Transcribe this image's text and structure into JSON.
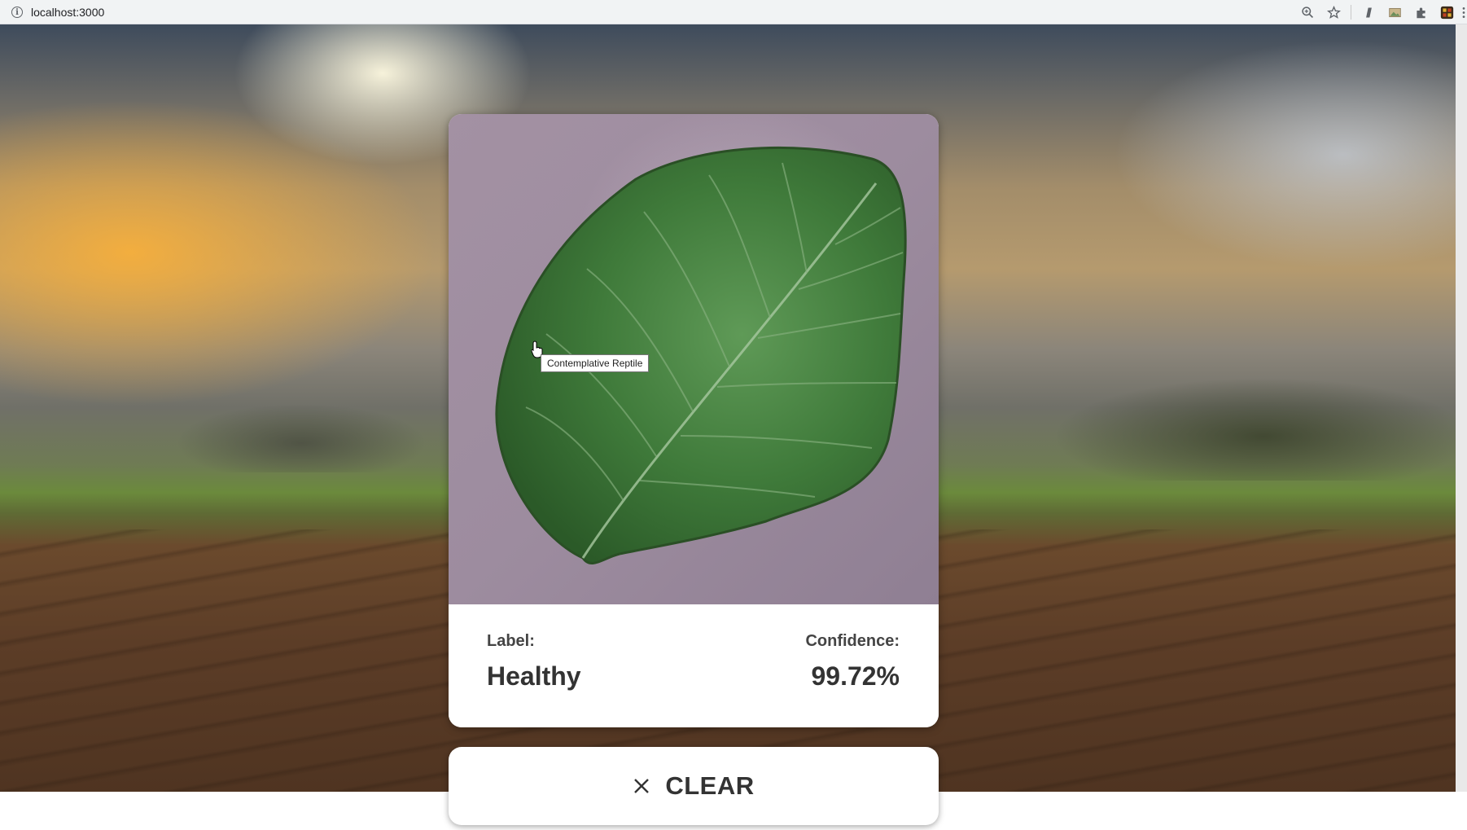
{
  "browser": {
    "url": "localhost:3000",
    "toolbar_icons": [
      "zoom-icon",
      "bookmark-star-icon",
      "extension-pen-icon",
      "extension-image-icon",
      "extensions-puzzle-icon",
      "profile-icon",
      "menu-icon"
    ]
  },
  "result": {
    "label_caption": "Label:",
    "label_value": "Healthy",
    "confidence_caption": "Confidence:",
    "confidence_value": "99.72%"
  },
  "tooltip": {
    "text": "Contemplative Reptile"
  },
  "clear_button": {
    "label": "CLEAR",
    "icon": "close-icon"
  },
  "colors": {
    "leaf_green": "#3f7a3a",
    "leaf_background": "#9d8c9f",
    "text_dark": "#333333"
  }
}
